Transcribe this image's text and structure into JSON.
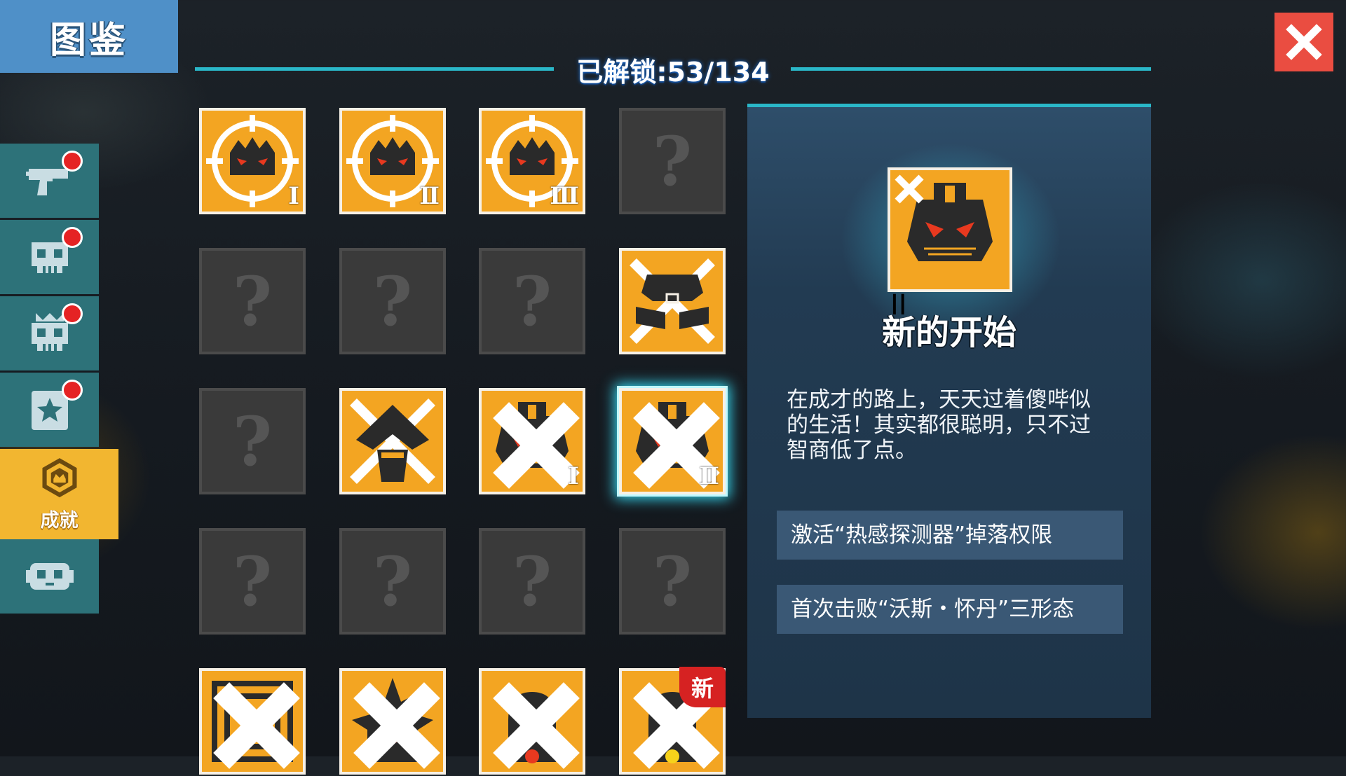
{
  "header": {
    "title": "图鉴"
  },
  "unlock": {
    "text": "已解锁:53/134"
  },
  "sidebar": {
    "items": [
      {
        "icon": "gun-icon",
        "badge": true
      },
      {
        "icon": "skull-icon",
        "badge": true
      },
      {
        "icon": "crowned-skull-icon",
        "badge": true
      },
      {
        "icon": "star-card-icon",
        "badge": true
      },
      {
        "icon": "achievement-emblem-icon",
        "label": "成就",
        "active": true
      },
      {
        "icon": "mask-icon",
        "badge": false
      }
    ]
  },
  "grid": {
    "tiles": [
      {
        "state": "unlocked",
        "icon": "crosshair-robot-icon",
        "roman": "I"
      },
      {
        "state": "unlocked",
        "icon": "crosshair-robot-icon",
        "roman": "II"
      },
      {
        "state": "unlocked",
        "icon": "crosshair-robot-icon",
        "roman": "III"
      },
      {
        "state": "locked",
        "mark": "?"
      },
      {
        "state": "locked",
        "mark": "?"
      },
      {
        "state": "locked",
        "mark": "?"
      },
      {
        "state": "locked",
        "mark": "?"
      },
      {
        "state": "unlocked",
        "icon": "crossed-helmet-icon"
      },
      {
        "state": "locked",
        "mark": "?"
      },
      {
        "state": "unlocked",
        "icon": "crossed-hooded-figure-icon"
      },
      {
        "state": "unlocked",
        "icon": "robot-head-icon",
        "roman": "I",
        "defeated": true
      },
      {
        "state": "unlocked",
        "icon": "robot-head-icon",
        "roman": "II",
        "defeated": true,
        "selected": true
      },
      {
        "state": "locked",
        "mark": "?"
      },
      {
        "state": "locked",
        "mark": "?"
      },
      {
        "state": "locked",
        "mark": "?"
      },
      {
        "state": "locked",
        "mark": "?"
      },
      {
        "state": "unlocked",
        "icon": "target-box-icon",
        "defeated": true
      },
      {
        "state": "unlocked",
        "icon": "spiky-head-icon",
        "defeated": true
      },
      {
        "state": "unlocked",
        "icon": "helmet-red-icon",
        "defeated": true
      },
      {
        "state": "unlocked",
        "icon": "helmet-yellow-icon",
        "defeated": true,
        "badge": "新"
      }
    ]
  },
  "detail": {
    "icon": "robot-head-icon",
    "roman": "II",
    "title": "新的开始",
    "description": "在成才的路上，天天过着傻哔似的生活！其实都很聪明，只不过智商低了点。",
    "conditions": [
      "激活“热感探测器”掉落权限",
      "首次击败“沃斯・怀丹”三形态"
    ]
  },
  "colors": {
    "accent": "#2ab7c8",
    "tile_unlocked": "#f3a522",
    "tile_locked": "#3a3a3a",
    "sidebar": "#2d7279",
    "sidebar_active": "#f2b630",
    "close": "#ea4d41",
    "badge": "#e52324"
  }
}
